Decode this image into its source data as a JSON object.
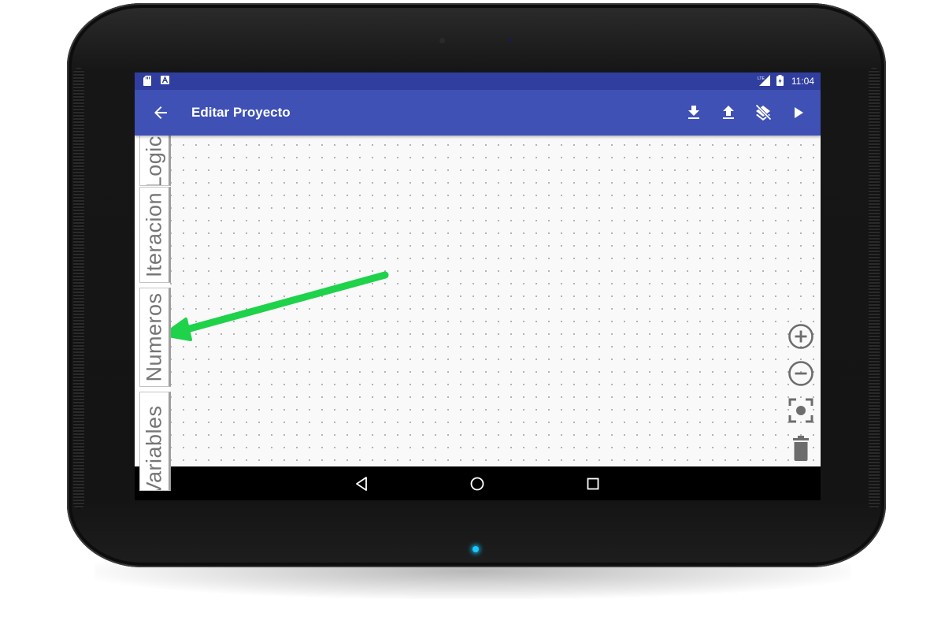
{
  "status_bar": {
    "time": "11:04",
    "left_icons": [
      "sd-card-icon",
      "a-notification-icon"
    ],
    "right_icons": [
      "lte-signal-icon",
      "battery-charging-icon"
    ]
  },
  "app_bar": {
    "title": "Editar Proyecto",
    "back_icon": "arrow-left-icon",
    "actions": [
      "download-icon",
      "upload-icon",
      "layers-off-icon",
      "play-icon"
    ]
  },
  "sidebar": {
    "tabs": [
      {
        "label": "Logica"
      },
      {
        "label": "Iteracion"
      },
      {
        "label": "Numeros"
      },
      {
        "label": "Variables"
      }
    ]
  },
  "workspace_controls": [
    "zoom-in-icon",
    "zoom-out-icon",
    "recenter-icon",
    "trash-icon"
  ],
  "nav_bar": [
    "back-triangle-icon",
    "home-circle-icon",
    "recents-square-icon"
  ],
  "colors": {
    "status_bar": "#303f9f",
    "app_bar": "#3f51b5",
    "workspace": "#f9f9f9",
    "annotation_arrow": "#1ed24a",
    "led": "#18c8ff"
  }
}
